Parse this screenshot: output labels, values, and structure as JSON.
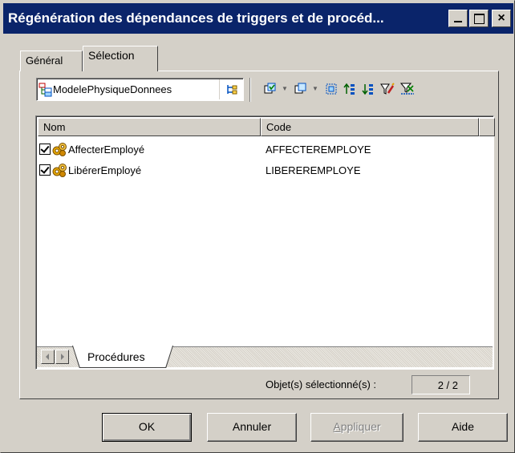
{
  "window": {
    "title": "Régénération des dépendances de triggers et de procéd..."
  },
  "tabs": [
    {
      "label": "Général",
      "active": false
    },
    {
      "label": "Sélection",
      "active": true
    }
  ],
  "model_selector": {
    "value": "ModelePhysiqueDonnees"
  },
  "toolbar": {
    "tools": [
      "select-all-icon",
      "deselect-all-icon",
      "select-in-diagram-icon",
      "sort-ascending-icon",
      "sort-descending-icon",
      "filter-icon",
      "clear-filter-icon"
    ]
  },
  "list": {
    "columns": [
      "Nom",
      "Code"
    ],
    "rows": [
      {
        "name": "AffecterEmployé",
        "code": "AFFECTEREMPLOYE",
        "checked": true
      },
      {
        "name": "LibérerEmployé",
        "code": "LIBEREREMPLOYE",
        "checked": true
      }
    ],
    "sheet_tab": "Procédures"
  },
  "status": {
    "selected_label": "Objet(s) sélectionné(s) :",
    "selected_value": "2 / 2"
  },
  "buttons": {
    "ok": "OK",
    "annuler": "Annuler",
    "appliquer_first": "A",
    "appliquer_rest": "ppliquer",
    "aide": "Aide"
  },
  "colors": {
    "titlebar": "#0a246a",
    "face": "#d4d0c8",
    "gear": "#e8a800"
  }
}
